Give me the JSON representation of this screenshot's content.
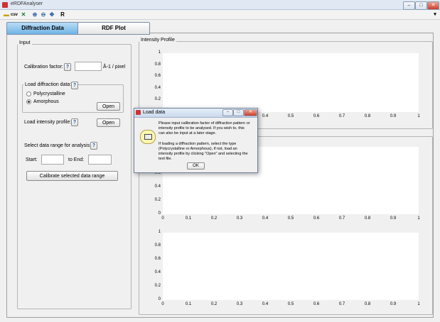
{
  "window": {
    "title": "eRDFAnalyser",
    "minimize": "–",
    "maximize": "□",
    "close": "✕"
  },
  "toolbar": {
    "icons": [
      "folder-open-icon",
      "csv-icon",
      "excel-icon",
      "zoom-in-icon",
      "zoom-out-icon",
      "pan-icon",
      "r-icon"
    ],
    "csv_label": "csv",
    "r_label": "R",
    "chevron": "▾"
  },
  "tabs": [
    {
      "label": "Diffraction Data",
      "active": true
    },
    {
      "label": "RDF Plot",
      "active": false
    }
  ],
  "input_panel": {
    "title": "Input",
    "calibration_label": "Calibration factor:",
    "calibration_value": "",
    "calibration_unit": "Å-1 / pixel",
    "load_group_label": "Load diffraction data:",
    "radio_polycrystalline": "Polycrystalline",
    "radio_amorphous": "Amorphous",
    "selected_radio": "Amorphous",
    "open_label": "Open",
    "load_profile_label": "Load intensity profile:",
    "open2_label": "Open",
    "select_range_label": "Select data range for analysis:",
    "start_label": "Start:",
    "start_value": "",
    "end_label": "to End:",
    "end_value": "",
    "calibrate_label": "Calibrate selected data range",
    "help": "?"
  },
  "intensity_panel": {
    "title": "Intensity Profile"
  },
  "axes": {
    "y_ticks": [
      "1",
      "0.8",
      "0.6",
      "0.4",
      "0.2",
      "0"
    ],
    "x_ticks": [
      "0",
      "0.1",
      "0.2",
      "0.3",
      "0.4",
      "0.5",
      "0.6",
      "0.7",
      "0.8",
      "0.9",
      "1"
    ]
  },
  "dialog": {
    "title": "Load data",
    "message1": "Please input calibration factor of diffraction pattern or intensity profile to be analysed. If you wish to, this can also be input at a later stage.",
    "message2": "If loading a diffraction pattern, select the type (Polycrystalline or Amorphous), if not, load an intensity profile by clicking \"Open\" and selecting the text file.",
    "ok_label": "OK"
  },
  "colors": {
    "active_tab": "#6fb4e6",
    "axes_bg": "#ffffff",
    "window_bg": "#f0f0f0"
  }
}
